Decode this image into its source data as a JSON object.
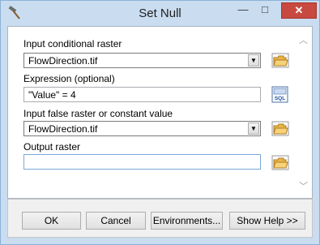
{
  "window": {
    "title": "Set Null"
  },
  "titlebar": {
    "minimize": "—",
    "maximize": "□",
    "close": "✕"
  },
  "params": {
    "in_cond_label": "Input conditional raster",
    "in_cond_value": "FlowDirection.tif",
    "expr_label": "Expression (optional)",
    "expr_value": "\"Value\" = 4",
    "false_label": "Input false raster or constant value",
    "false_value": "FlowDirection.tif",
    "out_label": "Output raster",
    "out_value": ""
  },
  "sql_icon_text": "SQL",
  "buttons": {
    "ok": "OK",
    "cancel": "Cancel",
    "env": "Environments...",
    "help": "Show Help >>"
  },
  "icons": [
    "hammer-icon",
    "folder-open-icon",
    "sql-icon",
    "chevron-down-icon",
    "chevron-up-icon",
    "minimize-icon",
    "maximize-icon",
    "close-icon"
  ]
}
